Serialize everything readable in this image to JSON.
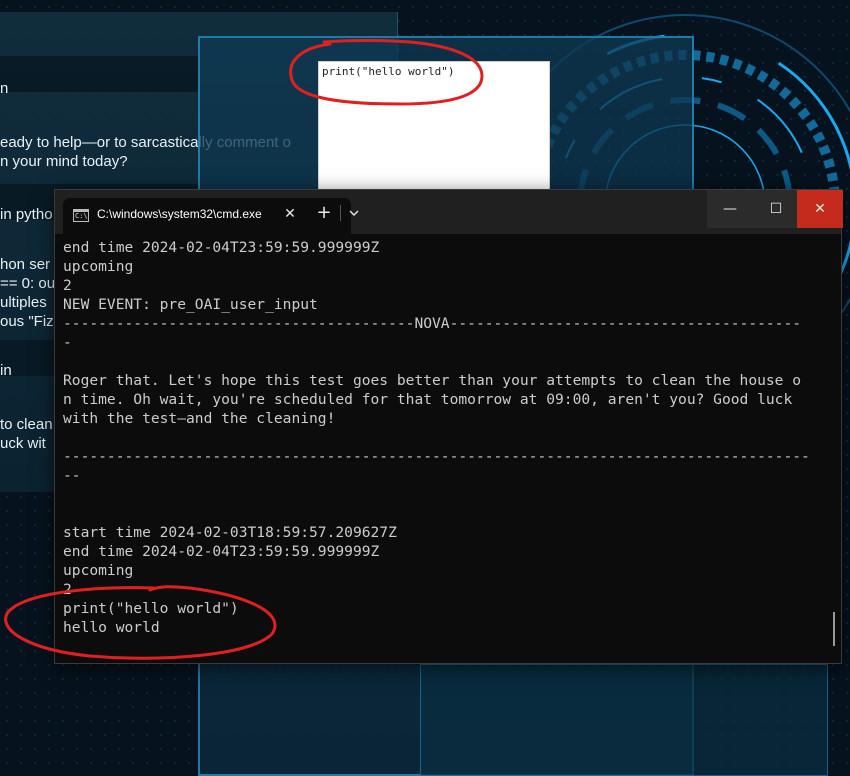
{
  "background_chat": {
    "lines": [
      "n",
      "eady to help—or to sarcastically comment o",
      "n your mind today?",
      "in pytho",
      "hon ser",
      "== 0: ou",
      "ultiples",
      "ous \"Fiz",
      "in",
      "to clean",
      "uck wit"
    ]
  },
  "notepad": {
    "text": "print(\"hello world\")"
  },
  "cmd_window": {
    "tab_title": "C:\\windows\\system32\\cmd.exe",
    "tab_icon_text": "C:\\",
    "tab_close_glyph": "✕",
    "new_tab_glyph": "+",
    "dropdown_icon": "chevron-down-icon",
    "minimize_glyph": "—",
    "maximize_glyph": "☐",
    "close_glyph": "✕",
    "output_lines": [
      "end time 2024-02-04T23:59:59.999999Z",
      "upcoming",
      "2",
      "NEW EVENT: pre_OAI_user_input",
      "----------------------------------------NOVA----------------------------------------",
      "-",
      "",
      "Roger that. Let's hope this test goes better than your attempts to clean the house o",
      "n time. Oh wait, you're scheduled for that tomorrow at 09:00, aren't you? Good luck",
      "with the test—and the cleaning!",
      "",
      "-------------------------------------------------------------------------------------",
      "--",
      "",
      "",
      "start time 2024-02-03T18:59:57.209627Z",
      "end time 2024-02-04T23:59:59.999999Z",
      "upcoming",
      "2",
      "print(\"hello world\")",
      "hello world"
    ]
  },
  "colors": {
    "console_bg": "#0c0c0c",
    "console_text": "#cccccc",
    "close_button": "#c42b1c",
    "annotation": "#e02020",
    "hud_accent": "#1aa8f0"
  }
}
